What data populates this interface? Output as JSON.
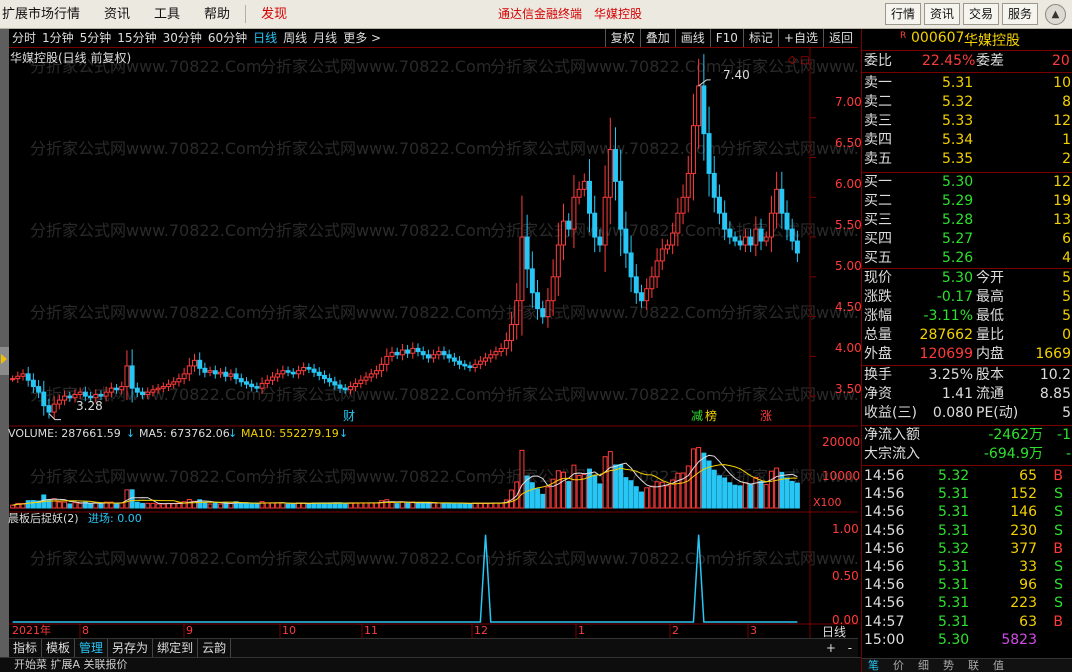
{
  "menu": {
    "items": [
      "扩展市场行情",
      "资讯",
      "工具",
      "帮助",
      "发现"
    ],
    "center": [
      "通达信金融终端",
      "华媒控股"
    ],
    "right": [
      "行情",
      "资讯",
      "交易",
      "服务"
    ]
  },
  "periods": {
    "items": [
      "分时",
      "1分钟",
      "5分钟",
      "15分钟",
      "30分钟",
      "60分钟",
      "日线",
      "周线",
      "月线",
      "更多 >"
    ],
    "active": "日线"
  },
  "tools": [
    "复权",
    "叠加",
    "画线",
    "F10",
    "标记",
    "+自选",
    "返回"
  ],
  "chart_title": "华媒控股(日线 前复权)",
  "price_axis": [
    "7.00",
    "6.50",
    "6.00",
    "5.50",
    "5.00",
    "4.50",
    "4.00",
    "3.50"
  ],
  "high_label": "7.40",
  "low_label": "3.28",
  "events": [
    "财",
    "减",
    "榜",
    "涨"
  ],
  "volume_header": {
    "vol": "VOLUME: 287661.59",
    "ma5": "MA5: 673762.06",
    "ma10": "MA10: 552279.19"
  },
  "volume_axis": [
    "20000",
    "10000"
  ],
  "volume_unit": "X100",
  "indicator_header": {
    "name": "晨板后捉妖(2)",
    "value": "进场: 0.00"
  },
  "indicator_axis": [
    "1.00",
    "0.50",
    "0.00"
  ],
  "date_axis": [
    "2021年",
    "8",
    "9",
    "10",
    "11",
    "12",
    "1",
    "2",
    "3"
  ],
  "bottom_period": "日线",
  "bottom_tabs": [
    "指标",
    "模板",
    "管理",
    "另存为",
    "绑定到",
    "云韵"
  ],
  "bottom_active": "管理",
  "status_text": "开始菜 扩展A 关联报价",
  "ipbottom": [
    "笔",
    "价",
    "细",
    "势",
    "联",
    "值"
  ],
  "watermark": "分折家公式网www.70822.Com",
  "info": {
    "flag": "R",
    "code": "000607",
    "name": "华媒控股",
    "weibi": {
      "label": "委比",
      "value": "22.45%",
      "label2": "委差",
      "value2": "20"
    },
    "asks": [
      {
        "label": "卖五",
        "price": "5.35",
        "vol": "2"
      },
      {
        "label": "卖四",
        "price": "5.34",
        "vol": "1"
      },
      {
        "label": "卖三",
        "price": "5.33",
        "vol": "12"
      },
      {
        "label": "卖二",
        "price": "5.32",
        "vol": "8"
      },
      {
        "label": "卖一",
        "price": "5.31",
        "vol": "10"
      }
    ],
    "bids": [
      {
        "label": "买一",
        "price": "5.30",
        "vol": "12"
      },
      {
        "label": "买二",
        "price": "5.29",
        "vol": "19"
      },
      {
        "label": "买三",
        "price": "5.28",
        "vol": "13"
      },
      {
        "label": "买四",
        "price": "5.27",
        "vol": "6"
      },
      {
        "label": "买五",
        "price": "5.26",
        "vol": "4"
      }
    ],
    "stats": [
      {
        "l1": "现价",
        "v1": "5.30",
        "c1": "g",
        "l2": "今开",
        "v2": "5"
      },
      {
        "l1": "涨跌",
        "v1": "-0.17",
        "c1": "g",
        "l2": "最高",
        "v2": "5"
      },
      {
        "l1": "涨幅",
        "v1": "-3.11%",
        "c1": "g",
        "l2": "最低",
        "v2": "5"
      },
      {
        "l1": "总量",
        "v1": "287662",
        "c1": "y",
        "l2": "量比",
        "v2": "0"
      },
      {
        "l1": "外盘",
        "v1": "120699",
        "c1": "r",
        "l2": "内盘",
        "v2": "1669"
      }
    ],
    "fund": [
      {
        "l1": "换手",
        "v1": "3.25%",
        "l2": "股本",
        "v2": "10.2"
      },
      {
        "l1": "净资",
        "v1": "1.41",
        "l2": "流通",
        "v2": "8.85"
      },
      {
        "l1": "收益(三)",
        "v1": "0.080",
        "l2": "PE(动)",
        "v2": "5"
      }
    ],
    "flow": [
      {
        "label": "净流入额",
        "value": "-2462万",
        "extra": "-1"
      },
      {
        "label": "大宗流入",
        "value": "-694.9万",
        "extra": "-"
      }
    ],
    "ticks": [
      {
        "t": "14:56",
        "p": "5.32",
        "v": "65",
        "d": "B"
      },
      {
        "t": "14:56",
        "p": "5.31",
        "v": "152",
        "d": "S"
      },
      {
        "t": "14:56",
        "p": "5.31",
        "v": "146",
        "d": "S"
      },
      {
        "t": "14:56",
        "p": "5.31",
        "v": "230",
        "d": "S"
      },
      {
        "t": "14:56",
        "p": "5.32",
        "v": "377",
        "d": "B"
      },
      {
        "t": "14:56",
        "p": "5.31",
        "v": "33",
        "d": "S"
      },
      {
        "t": "14:56",
        "p": "5.31",
        "v": "96",
        "d": "S"
      },
      {
        "t": "14:56",
        "p": "5.31",
        "v": "223",
        "d": "S"
      },
      {
        "t": "14:57",
        "p": "5.31",
        "v": "63",
        "d": "B"
      },
      {
        "t": "15:00",
        "p": "5.30",
        "v": "5823",
        "d": ""
      }
    ]
  },
  "chart_data": {
    "type": "candlestick",
    "title": "华媒控股(日线 前复权)",
    "price_ylim": [
      3.2,
      7.6
    ],
    "closes": [
      3.72,
      3.75,
      3.78,
      3.7,
      3.62,
      3.55,
      3.38,
      3.3,
      3.4,
      3.45,
      3.5,
      3.48,
      3.52,
      3.55,
      3.5,
      3.48,
      3.52,
      3.5,
      3.55,
      3.6,
      3.58,
      3.62,
      3.88,
      3.6,
      3.55,
      3.52,
      3.55,
      3.58,
      3.6,
      3.62,
      3.65,
      3.68,
      3.72,
      3.78,
      3.88,
      3.95,
      3.85,
      3.8,
      3.82,
      3.78,
      3.8,
      3.75,
      3.78,
      3.72,
      3.68,
      3.65,
      3.62,
      3.6,
      3.66,
      3.7,
      3.74,
      3.78,
      3.82,
      3.8,
      3.78,
      3.82,
      3.86,
      3.84,
      3.8,
      3.76,
      3.72,
      3.68,
      3.64,
      3.6,
      3.58,
      3.62,
      3.66,
      3.7,
      3.74,
      3.78,
      3.82,
      3.9,
      4.0,
      4.05,
      4.02,
      4.08,
      4.04,
      4.1,
      4.06,
      4.02,
      3.98,
      4.02,
      4.06,
      4.02,
      3.98,
      3.94,
      3.9,
      3.88,
      3.86,
      3.9,
      3.94,
      3.98,
      4.02,
      4.06,
      4.1,
      4.2,
      4.4,
      4.7,
      5.5,
      5.1,
      4.8,
      4.6,
      4.5,
      4.7,
      5.0,
      5.4,
      5.7,
      5.6,
      6.0,
      6.1,
      6.2,
      5.8,
      5.5,
      5.4,
      6.0,
      6.6,
      6.2,
      5.6,
      5.3,
      5.0,
      4.8,
      4.7,
      4.85,
      5.0,
      5.2,
      5.35,
      5.4,
      5.55,
      5.8,
      6.0,
      6.3,
      6.9,
      7.4,
      6.8,
      6.3,
      6.0,
      5.8,
      5.6,
      5.5,
      5.45,
      5.4,
      5.5,
      5.4,
      5.6,
      5.45,
      5.5,
      5.8,
      6.1,
      5.8,
      5.6,
      5.45,
      5.3
    ],
    "volume_ylim": [
      0,
      22000
    ],
    "indicator_ylim": [
      0,
      1.1
    ],
    "signals": [
      {
        "index": 91,
        "value": 1.0
      },
      {
        "index": 132,
        "value": 1.0
      }
    ],
    "high": 7.4,
    "low": 3.28
  }
}
